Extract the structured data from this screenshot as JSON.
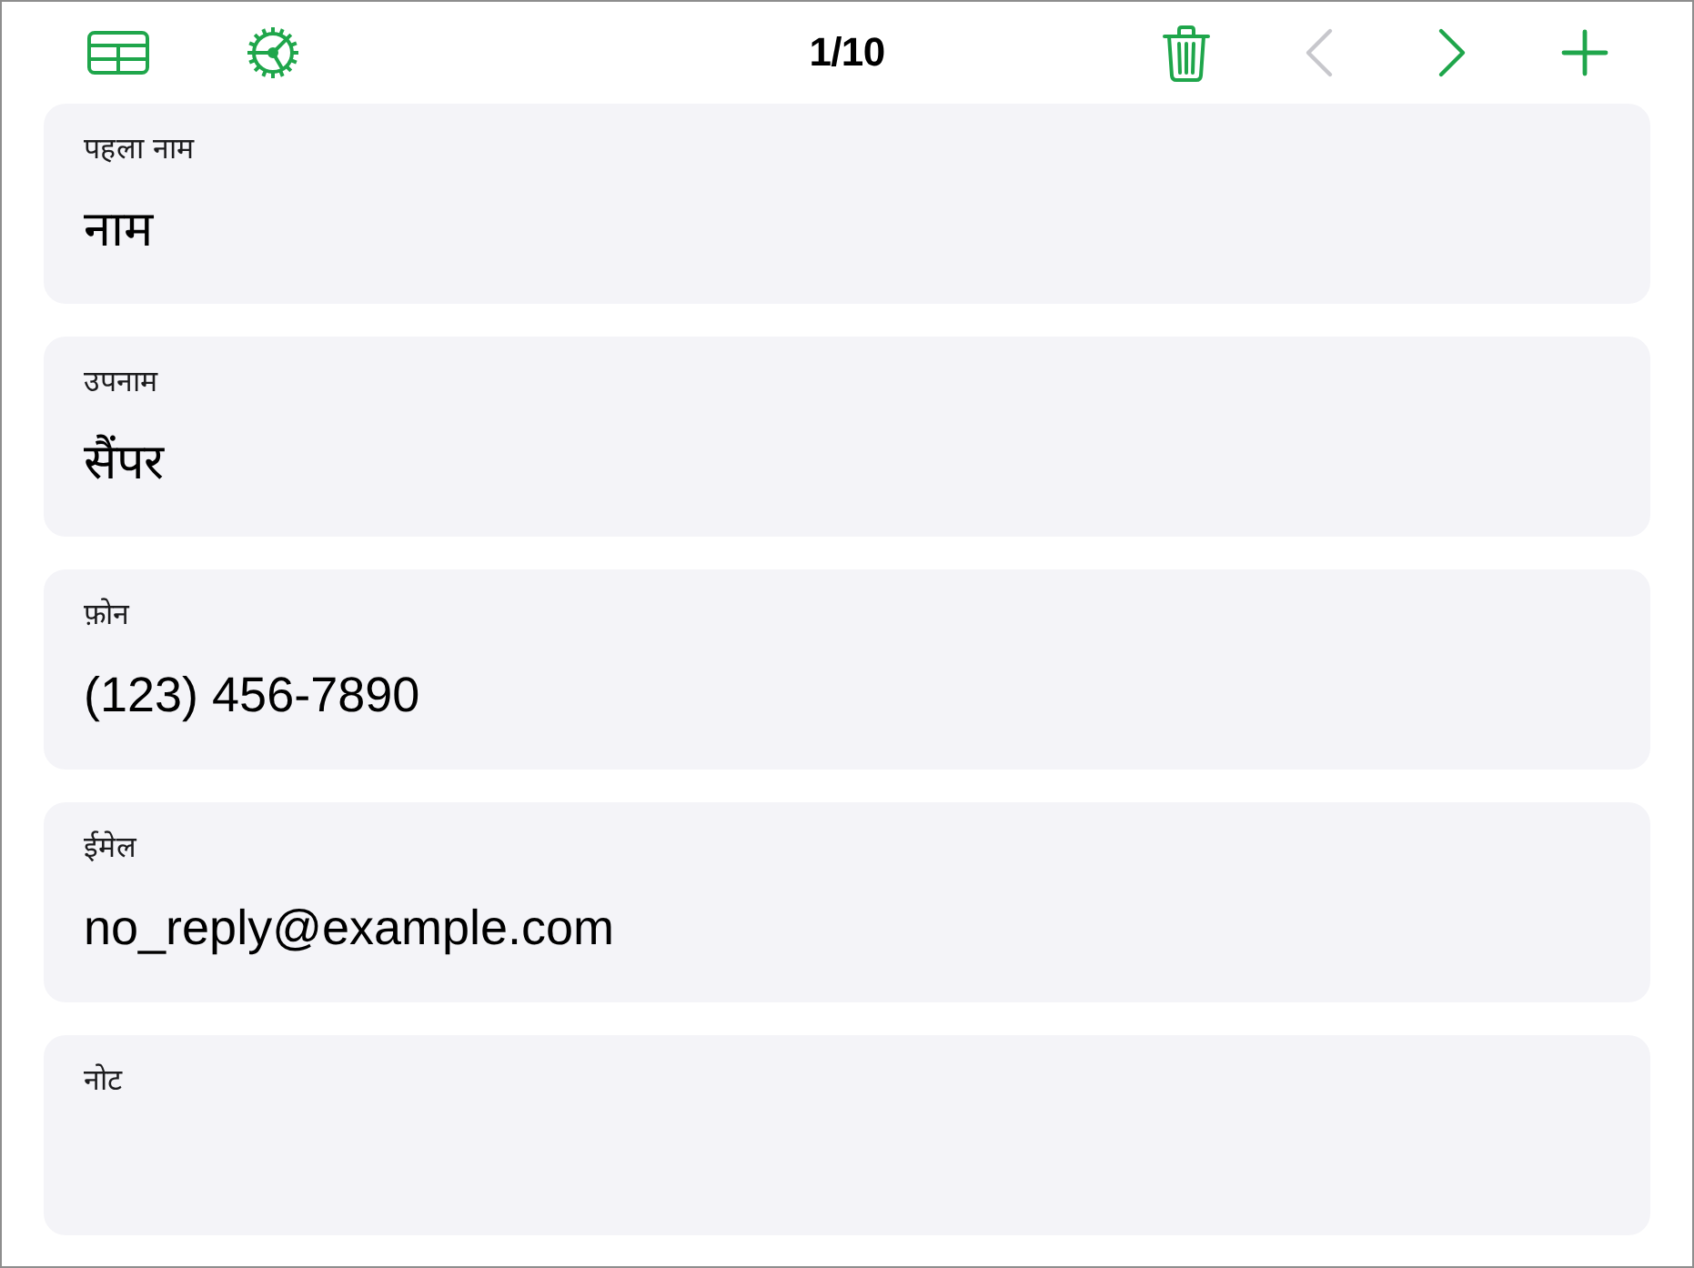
{
  "toolbar": {
    "left": [
      {
        "kind": "table",
        "disabled": false
      },
      {
        "kind": "settings",
        "disabled": false
      }
    ],
    "counter": "1/10",
    "right": [
      {
        "kind": "delete",
        "disabled": false
      },
      {
        "kind": "previous",
        "disabled": true
      },
      {
        "kind": "next",
        "disabled": false
      },
      {
        "kind": "add",
        "disabled": false
      }
    ]
  },
  "fields": [
    {
      "label": "पहला नाम",
      "value": "नाम"
    },
    {
      "label": "उपनाम",
      "value": "सैंपर"
    },
    {
      "label": "फ़ोन",
      "value": "(123) 456-7890"
    },
    {
      "label": "ईमेल",
      "value": "no_reply@example.com"
    },
    {
      "label": "नोट"
    }
  ]
}
